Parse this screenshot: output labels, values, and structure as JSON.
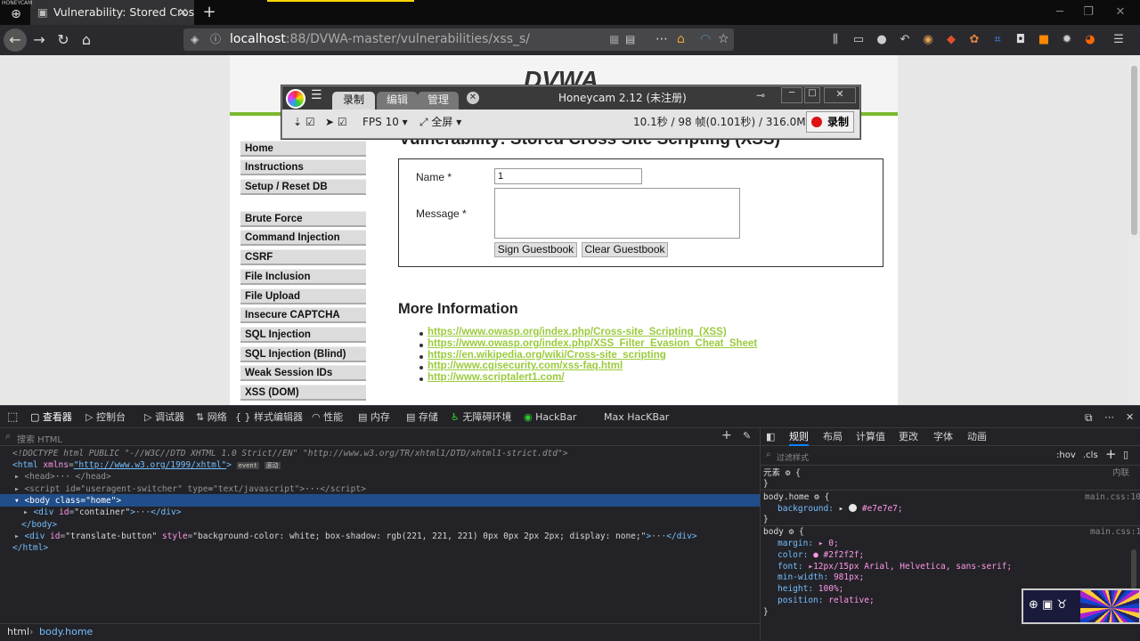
{
  "watermark": "HONEYCAM",
  "browser": {
    "tab_title": "Vulnerability: Stored Cross",
    "url_host": "localhost",
    "url_rest": ":88/DVWA-master/vulnerabilities/xss_s/"
  },
  "page": {
    "logo": "DVWA",
    "title": "Vulnerability: Stored Cross Site Scripting (XSS)",
    "menu": [
      "Home",
      "Instructions",
      "Setup / Reset DB",
      "Brute Force",
      "Command Injection",
      "CSRF",
      "File Inclusion",
      "File Upload",
      "Insecure CAPTCHA",
      "SQL Injection",
      "SQL Injection (Blind)",
      "Weak Session IDs",
      "XSS (DOM)"
    ],
    "form": {
      "name_label": "Name *",
      "name_value": "1",
      "message_label": "Message *",
      "sign_button": "Sign Guestbook",
      "clear_button": "Clear Guestbook"
    },
    "more_info_title": "More Information",
    "links": [
      "https://www.owasp.org/index.php/Cross-site_Scripting_(XSS)",
      "https://www.owasp.org/index.php/XSS_Filter_Evasion_Cheat_Sheet",
      "https://en.wikipedia.org/wiki/Cross-site_scripting",
      "http://www.cgisecurity.com/xss-faq.html",
      "http://www.scriptalert1.com/"
    ]
  },
  "honeycam": {
    "tabs": [
      "录制",
      "编辑",
      "管理"
    ],
    "title": "Honeycam 2.12 (未注册)",
    "fps": "FPS 10",
    "mode": "全屏",
    "stats": "10.1秒 / 98 帧(0.101秒) / 316.0MB",
    "record": "录制"
  },
  "devtools": {
    "tabs": [
      "查看器",
      "控制台",
      "调试器",
      "网络",
      "样式编辑器",
      "性能",
      "内存",
      "存储",
      "无障碍环境",
      "HackBar",
      "Max HacKBar"
    ],
    "search_placeholder": "搜索 HTML",
    "breadcrumb": [
      "html",
      "body.home"
    ],
    "side_tabs": [
      "规则",
      "布局",
      "计算值",
      "更改",
      "字体",
      "动画"
    ],
    "filter_placeholder": "过滤样式",
    "hov": ":hov",
    "cls": ".cls",
    "element_label": "元素 ⚙ {",
    "inline_label": "内联",
    "rule1": {
      "selector": "body.home ⚙ {",
      "prop": "background:",
      "value": "#e7e7e7;",
      "file": "main.css:10"
    },
    "rule2": {
      "selector": "body ⚙ {",
      "file": "main.css:1",
      "props": [
        [
          "margin:",
          "▸ 0;"
        ],
        [
          "color:",
          "● #2f2f2f;"
        ],
        [
          "font:",
          "▸12px/15px Arial, Helvetica, sans-serif;"
        ],
        [
          "min-width:",
          "981px;"
        ],
        [
          "height:",
          "100%;"
        ],
        [
          "position:",
          "relative;"
        ]
      ]
    }
  },
  "colors": {
    "accent": "#7ab82e",
    "link": "#9acb3c",
    "devtools_bg": "#232327",
    "selected": "#204e8a"
  }
}
